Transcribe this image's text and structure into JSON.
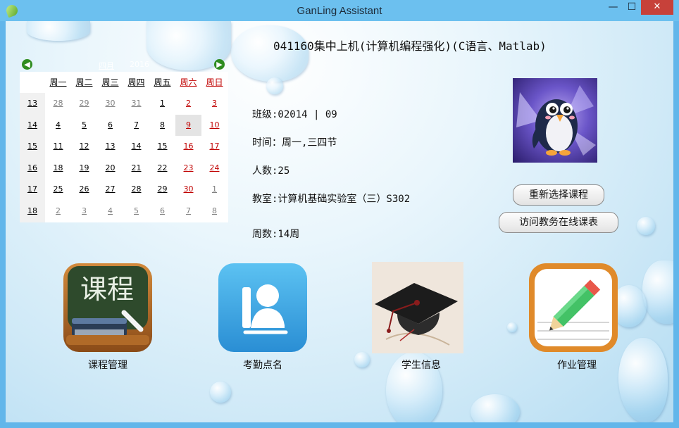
{
  "window": {
    "title": "GanLing Assistant",
    "minimize_glyph": "—",
    "maximize_glyph": "☐",
    "close_glyph": "✕"
  },
  "course": {
    "title": "041160集中上机(计算机编程强化)(C语言、Matlab)"
  },
  "calendar": {
    "month": "四月",
    "year": "2016",
    "prev_glyph": "◀",
    "next_glyph": "▶",
    "weekdays": [
      "周一",
      "周二",
      "周三",
      "周四",
      "周五",
      "周六",
      "周日"
    ],
    "weeks": [
      {
        "num": "13",
        "days": [
          "28",
          "29",
          "30",
          "31",
          "1",
          "2",
          "3"
        ]
      },
      {
        "num": "14",
        "days": [
          "4",
          "5",
          "6",
          "7",
          "8",
          "9",
          "10"
        ]
      },
      {
        "num": "15",
        "days": [
          "11",
          "12",
          "13",
          "14",
          "15",
          "16",
          "17"
        ]
      },
      {
        "num": "16",
        "days": [
          "18",
          "19",
          "20",
          "21",
          "22",
          "23",
          "24"
        ]
      },
      {
        "num": "17",
        "days": [
          "25",
          "26",
          "27",
          "28",
          "29",
          "30",
          "1"
        ]
      },
      {
        "num": "18",
        "days": [
          "2",
          "3",
          "4",
          "5",
          "6",
          "7",
          "8"
        ]
      }
    ]
  },
  "info": {
    "class": "班级:02014 | 09",
    "time": "时间：周一,三四节",
    "count": "人数:25",
    "room": "教室:计算机基础实验室（三）S302",
    "weeks": "周数:14周"
  },
  "buttons": {
    "reselect": "重新选择课程",
    "online_schedule": "访问教务在线课表"
  },
  "tiles": [
    {
      "label": "课程管理",
      "icon": "chalkboard-icon",
      "icon_text": "课程"
    },
    {
      "label": "考勤点名",
      "icon": "attendance-user-icon"
    },
    {
      "label": "学生信息",
      "icon": "graduation-cap-icon"
    },
    {
      "label": "作业管理",
      "icon": "pencil-notepad-icon"
    }
  ],
  "colors": {
    "titlebar": "#6cc0ef",
    "close_button": "#c7413a",
    "weekend_red": "#c00000",
    "nav_green": "#2f8c1f"
  }
}
